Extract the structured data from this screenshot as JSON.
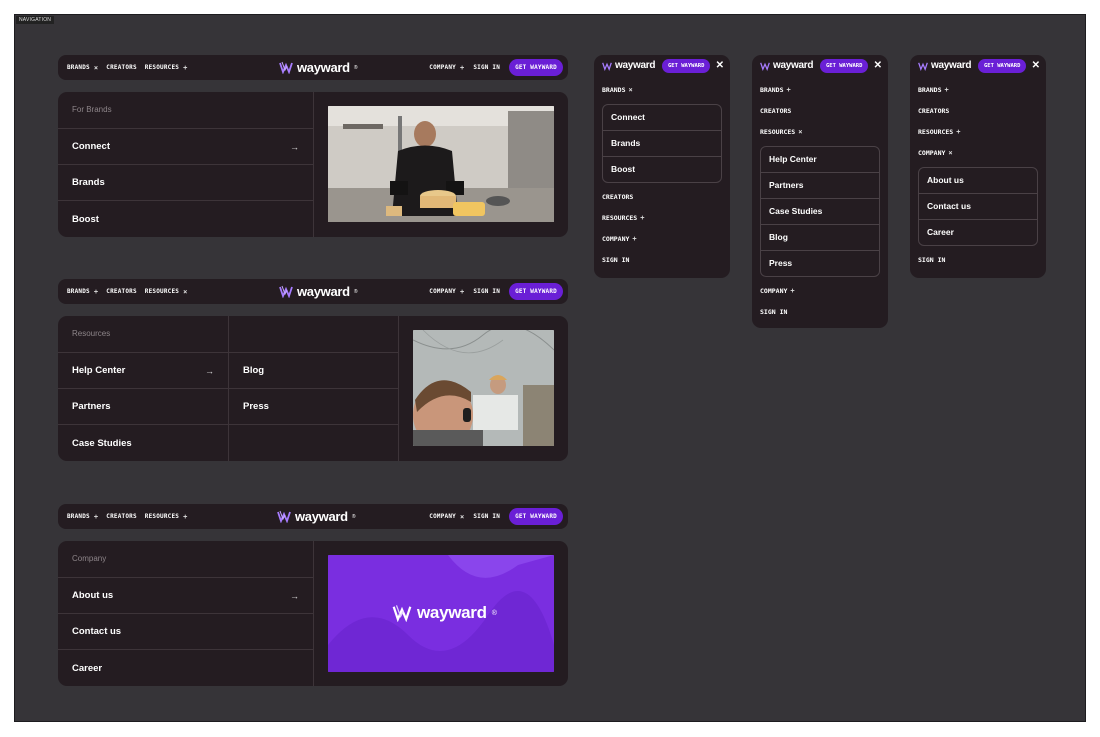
{
  "frame_label": "NAVIGATION",
  "brand": {
    "name": "wayward",
    "mark": "®",
    "accent": "#6a1fd6"
  },
  "nav": {
    "brands": "BRANDS",
    "creators": "CREATORS",
    "resources": "RESOURCES",
    "company": "COMPANY",
    "sign_in": "SIGN IN",
    "cta": "GET WAYWARD",
    "plus": "+",
    "close": "×"
  },
  "brands_panel": {
    "heading": "For Brands",
    "items": [
      "Connect",
      "Brands",
      "Boost"
    ],
    "arrow": "→",
    "photo_icon": "chef-cutting-cheese-photo"
  },
  "resources_panel": {
    "heading": "Resources",
    "col1": [
      "Help Center",
      "Partners",
      "Case Studies"
    ],
    "col2": [
      "Blog",
      "Press"
    ],
    "arrow": "→",
    "photo_icon": "support-agent-headset-photo"
  },
  "company_panel": {
    "heading": "Company",
    "items": [
      "About us",
      "Contact us",
      "Career"
    ],
    "arrow": "→"
  },
  "mobile": {
    "close": "✕",
    "brands_sub": [
      "Connect",
      "Brands",
      "Boost"
    ],
    "resources_sub": [
      "Help Center",
      "Partners",
      "Case Studies",
      "Blog",
      "Press"
    ],
    "company_sub": [
      "About us",
      "Contact us",
      "Career"
    ]
  }
}
